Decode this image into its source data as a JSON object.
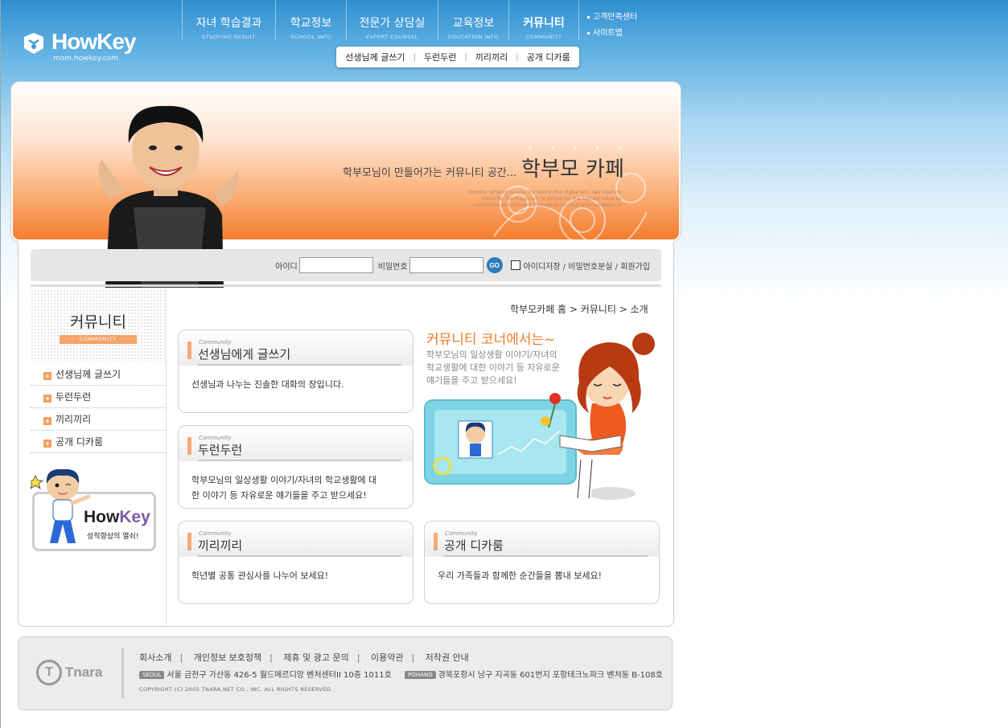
{
  "header": {
    "logo_name": "HowKey",
    "logo_url": "mom.howkey.com",
    "gnb": [
      {
        "ko": "자녀 학습결과",
        "en": "STUDYING RESULT"
      },
      {
        "ko": "학교정보",
        "en": "SCHOOL INFO"
      },
      {
        "ko": "전문가 상담실",
        "en": "EXPERT COUNSEL"
      },
      {
        "ko": "교육정보",
        "en": "EDUCATION INFO"
      },
      {
        "ko": "커뮤니티",
        "en": "COMMUNITY"
      }
    ],
    "util": [
      "고객만족센터",
      "사이트맵"
    ],
    "subnav": [
      "선생님께 글쓰기",
      "두런두런",
      "끼리끼리",
      "공개 디카룸"
    ]
  },
  "banner": {
    "tagline": "학부모님이 만들어가는 커뮤니티 공간...",
    "title": "학부모 카페",
    "english": "HowKey striving to take the lead in the digital era, has reset its vision  for the maximum to delivering the highest value to customers and partners through technological innovations in"
  },
  "login": {
    "id_label": "아이디",
    "pw_label": "비밀번호",
    "go_label": "GO",
    "links": "아이디저장 / 비밀번호분실 / 회원가입"
  },
  "sidebar": {
    "title": "커뮤니티",
    "title_en": "COMMUNITY",
    "items": [
      "선생님께 글쓰기",
      "두런두런",
      "끼리끼리",
      "공개 디카룸"
    ],
    "ad_brand_a": "How",
    "ad_brand_b": "Key",
    "ad_caption": "성적향상의 열쇠!"
  },
  "breadcrumb": "학부모카페 홈 > 커뮤니티 > 소개",
  "intro": {
    "heading": "커뮤니티 코너에서는~",
    "text": "학부모님의 일상생활 이야기/자녀의 학교생활에 대한 이야기 등 자유로운 얘기들을 주고 받으세요!"
  },
  "cards": [
    {
      "small": "Community",
      "title": "선생님에게 글쓰기",
      "desc": "선생님과 나누는 진솔한 대화의 장입니다."
    },
    {
      "small": "Community",
      "title": "두런두런",
      "desc": "학부모님의 일상생활 이야기/자녀의 학교생활에 대한 이야기 등 자유로운 얘기들을 주고 받으세요!"
    },
    {
      "small": "Community",
      "title": "끼리끼리",
      "desc": "학년별 공통 관심사를 나누어 보세요!"
    },
    {
      "small": "Community",
      "title": "공개 디카룸",
      "desc": "우리 가족들과 함께한 순간들을 뽐내 보세요!"
    }
  ],
  "footer": {
    "logo_text": "Tnara",
    "links": [
      "회사소개",
      "개인정보 보호정책",
      "제휴 및 광고 문의",
      "이용약관",
      "저작권 안내"
    ],
    "seoul_tag": "SEOUL",
    "seoul_addr": "서울 금천구 가산동 426-5 월드메르디앙 벤처센터II 10층 1011호",
    "pohang_tag": "POHANG",
    "pohang_addr": "경북포항시 남구 지곡동 601번지 포항테크노파크 벤처동 B-108호",
    "copyright": "COPYRIGHT (C) 2005 TNARA.NET CO., INC. ALL RIGHTS RESERVED."
  },
  "colors": {
    "accent_orange": "#f07a2a",
    "sky": "#2f8fd0",
    "go_blue": "#2f7db8"
  }
}
